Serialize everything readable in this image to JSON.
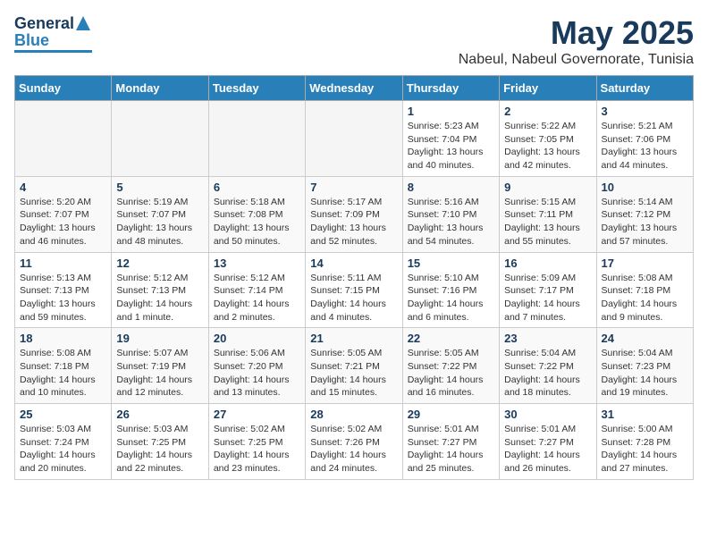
{
  "logo": {
    "line1": "General",
    "line2": "Blue"
  },
  "title": "May 2025",
  "location": "Nabeul, Nabeul Governorate, Tunisia",
  "weekdays": [
    "Sunday",
    "Monday",
    "Tuesday",
    "Wednesday",
    "Thursday",
    "Friday",
    "Saturday"
  ],
  "weeks": [
    [
      {
        "day": "",
        "info": ""
      },
      {
        "day": "",
        "info": ""
      },
      {
        "day": "",
        "info": ""
      },
      {
        "day": "",
        "info": ""
      },
      {
        "day": "1",
        "info": "Sunrise: 5:23 AM\nSunset: 7:04 PM\nDaylight: 13 hours\nand 40 minutes."
      },
      {
        "day": "2",
        "info": "Sunrise: 5:22 AM\nSunset: 7:05 PM\nDaylight: 13 hours\nand 42 minutes."
      },
      {
        "day": "3",
        "info": "Sunrise: 5:21 AM\nSunset: 7:06 PM\nDaylight: 13 hours\nand 44 minutes."
      }
    ],
    [
      {
        "day": "4",
        "info": "Sunrise: 5:20 AM\nSunset: 7:07 PM\nDaylight: 13 hours\nand 46 minutes."
      },
      {
        "day": "5",
        "info": "Sunrise: 5:19 AM\nSunset: 7:07 PM\nDaylight: 13 hours\nand 48 minutes."
      },
      {
        "day": "6",
        "info": "Sunrise: 5:18 AM\nSunset: 7:08 PM\nDaylight: 13 hours\nand 50 minutes."
      },
      {
        "day": "7",
        "info": "Sunrise: 5:17 AM\nSunset: 7:09 PM\nDaylight: 13 hours\nand 52 minutes."
      },
      {
        "day": "8",
        "info": "Sunrise: 5:16 AM\nSunset: 7:10 PM\nDaylight: 13 hours\nand 54 minutes."
      },
      {
        "day": "9",
        "info": "Sunrise: 5:15 AM\nSunset: 7:11 PM\nDaylight: 13 hours\nand 55 minutes."
      },
      {
        "day": "10",
        "info": "Sunrise: 5:14 AM\nSunset: 7:12 PM\nDaylight: 13 hours\nand 57 minutes."
      }
    ],
    [
      {
        "day": "11",
        "info": "Sunrise: 5:13 AM\nSunset: 7:13 PM\nDaylight: 13 hours\nand 59 minutes."
      },
      {
        "day": "12",
        "info": "Sunrise: 5:12 AM\nSunset: 7:13 PM\nDaylight: 14 hours\nand 1 minute."
      },
      {
        "day": "13",
        "info": "Sunrise: 5:12 AM\nSunset: 7:14 PM\nDaylight: 14 hours\nand 2 minutes."
      },
      {
        "day": "14",
        "info": "Sunrise: 5:11 AM\nSunset: 7:15 PM\nDaylight: 14 hours\nand 4 minutes."
      },
      {
        "day": "15",
        "info": "Sunrise: 5:10 AM\nSunset: 7:16 PM\nDaylight: 14 hours\nand 6 minutes."
      },
      {
        "day": "16",
        "info": "Sunrise: 5:09 AM\nSunset: 7:17 PM\nDaylight: 14 hours\nand 7 minutes."
      },
      {
        "day": "17",
        "info": "Sunrise: 5:08 AM\nSunset: 7:18 PM\nDaylight: 14 hours\nand 9 minutes."
      }
    ],
    [
      {
        "day": "18",
        "info": "Sunrise: 5:08 AM\nSunset: 7:18 PM\nDaylight: 14 hours\nand 10 minutes."
      },
      {
        "day": "19",
        "info": "Sunrise: 5:07 AM\nSunset: 7:19 PM\nDaylight: 14 hours\nand 12 minutes."
      },
      {
        "day": "20",
        "info": "Sunrise: 5:06 AM\nSunset: 7:20 PM\nDaylight: 14 hours\nand 13 minutes."
      },
      {
        "day": "21",
        "info": "Sunrise: 5:05 AM\nSunset: 7:21 PM\nDaylight: 14 hours\nand 15 minutes."
      },
      {
        "day": "22",
        "info": "Sunrise: 5:05 AM\nSunset: 7:22 PM\nDaylight: 14 hours\nand 16 minutes."
      },
      {
        "day": "23",
        "info": "Sunrise: 5:04 AM\nSunset: 7:22 PM\nDaylight: 14 hours\nand 18 minutes."
      },
      {
        "day": "24",
        "info": "Sunrise: 5:04 AM\nSunset: 7:23 PM\nDaylight: 14 hours\nand 19 minutes."
      }
    ],
    [
      {
        "day": "25",
        "info": "Sunrise: 5:03 AM\nSunset: 7:24 PM\nDaylight: 14 hours\nand 20 minutes."
      },
      {
        "day": "26",
        "info": "Sunrise: 5:03 AM\nSunset: 7:25 PM\nDaylight: 14 hours\nand 22 minutes."
      },
      {
        "day": "27",
        "info": "Sunrise: 5:02 AM\nSunset: 7:25 PM\nDaylight: 14 hours\nand 23 minutes."
      },
      {
        "day": "28",
        "info": "Sunrise: 5:02 AM\nSunset: 7:26 PM\nDaylight: 14 hours\nand 24 minutes."
      },
      {
        "day": "29",
        "info": "Sunrise: 5:01 AM\nSunset: 7:27 PM\nDaylight: 14 hours\nand 25 minutes."
      },
      {
        "day": "30",
        "info": "Sunrise: 5:01 AM\nSunset: 7:27 PM\nDaylight: 14 hours\nand 26 minutes."
      },
      {
        "day": "31",
        "info": "Sunrise: 5:00 AM\nSunset: 7:28 PM\nDaylight: 14 hours\nand 27 minutes."
      }
    ]
  ]
}
